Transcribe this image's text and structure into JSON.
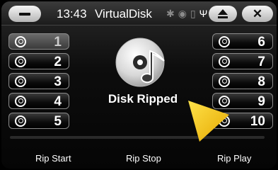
{
  "status_bar": {
    "time": "13:43",
    "title": "VirtualDisk",
    "icons": [
      "bluetooth-icon",
      "disc-icon",
      "sd-card-icon",
      "usb-icon"
    ],
    "eject_icon": "eject-icon",
    "close_label": "✕"
  },
  "tracks_left": [
    {
      "number": "1",
      "active": true
    },
    {
      "number": "2",
      "active": false
    },
    {
      "number": "3",
      "active": false
    },
    {
      "number": "4",
      "active": false
    },
    {
      "number": "5",
      "active": false
    }
  ],
  "tracks_right": [
    {
      "number": "6"
    },
    {
      "number": "7"
    },
    {
      "number": "8"
    },
    {
      "number": "9"
    },
    {
      "number": "10"
    }
  ],
  "center": {
    "status": "Disk Ripped",
    "icon": "music-cd-icon"
  },
  "bottom": {
    "rip_start": "Rip Start",
    "rip_stop": "Rip Stop",
    "rip_play": "Rip Play"
  },
  "colors": {
    "accent_arrow": "#f5c400",
    "button_gradient_top": "#f5f5f5",
    "button_gradient_bottom": "#b5b5b5"
  }
}
